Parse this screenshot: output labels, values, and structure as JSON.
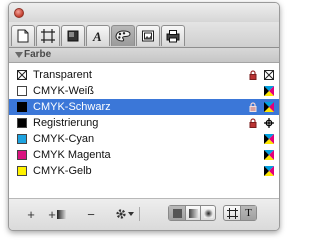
{
  "window": {
    "close_color": "#d24b3b"
  },
  "tabs": [
    {
      "icon": "document-icon",
      "active": false
    },
    {
      "icon": "crop-frame-icon",
      "active": false
    },
    {
      "icon": "shadow-box-icon",
      "active": false
    },
    {
      "icon": "text-a-icon",
      "active": false
    },
    {
      "icon": "color-palette-icon",
      "active": true
    },
    {
      "icon": "image-frame-icon",
      "active": false
    },
    {
      "icon": "print-icon",
      "active": false
    }
  ],
  "section": {
    "title": "Farbe"
  },
  "colors": [
    {
      "name": "Transparent",
      "swatch": "none",
      "locked": true,
      "mode": "none-icon",
      "selected": false
    },
    {
      "name": "CMYK-Weiß",
      "swatch": "#ffffff",
      "locked": false,
      "mode": "cmyk-icon",
      "selected": false
    },
    {
      "name": "CMYK-Schwarz",
      "swatch": "#000000",
      "locked": true,
      "mode": "cmyk-icon",
      "selected": true
    },
    {
      "name": "Registrierung",
      "swatch": "#000000",
      "locked": true,
      "mode": "registration-icon",
      "selected": false
    },
    {
      "name": "CMYK-Cyan",
      "swatch": "#1ea3e0",
      "locked": false,
      "mode": "cmyk-icon",
      "selected": false
    },
    {
      "name": "CMYK Magenta",
      "swatch": "#d9137f",
      "locked": false,
      "mode": "cmyk-icon",
      "selected": false
    },
    {
      "name": "CMYK-Gelb",
      "swatch": "#fff200",
      "locked": false,
      "mode": "cmyk-icon",
      "selected": false
    }
  ],
  "toolbar": {
    "add_label": "+",
    "add_gradient_label": "+",
    "delete_label": "−",
    "actions_icon": "gear-icon",
    "fill_modes": [
      "solid-fill-icon",
      "linear-gradient-icon",
      "radial-gradient-icon"
    ],
    "fill_mode_selected": 0,
    "targets": [
      "frame-target-icon",
      "text-target-icon"
    ],
    "text_target_label": "T"
  },
  "colors_accent": {
    "selection": "#3b77d8"
  }
}
